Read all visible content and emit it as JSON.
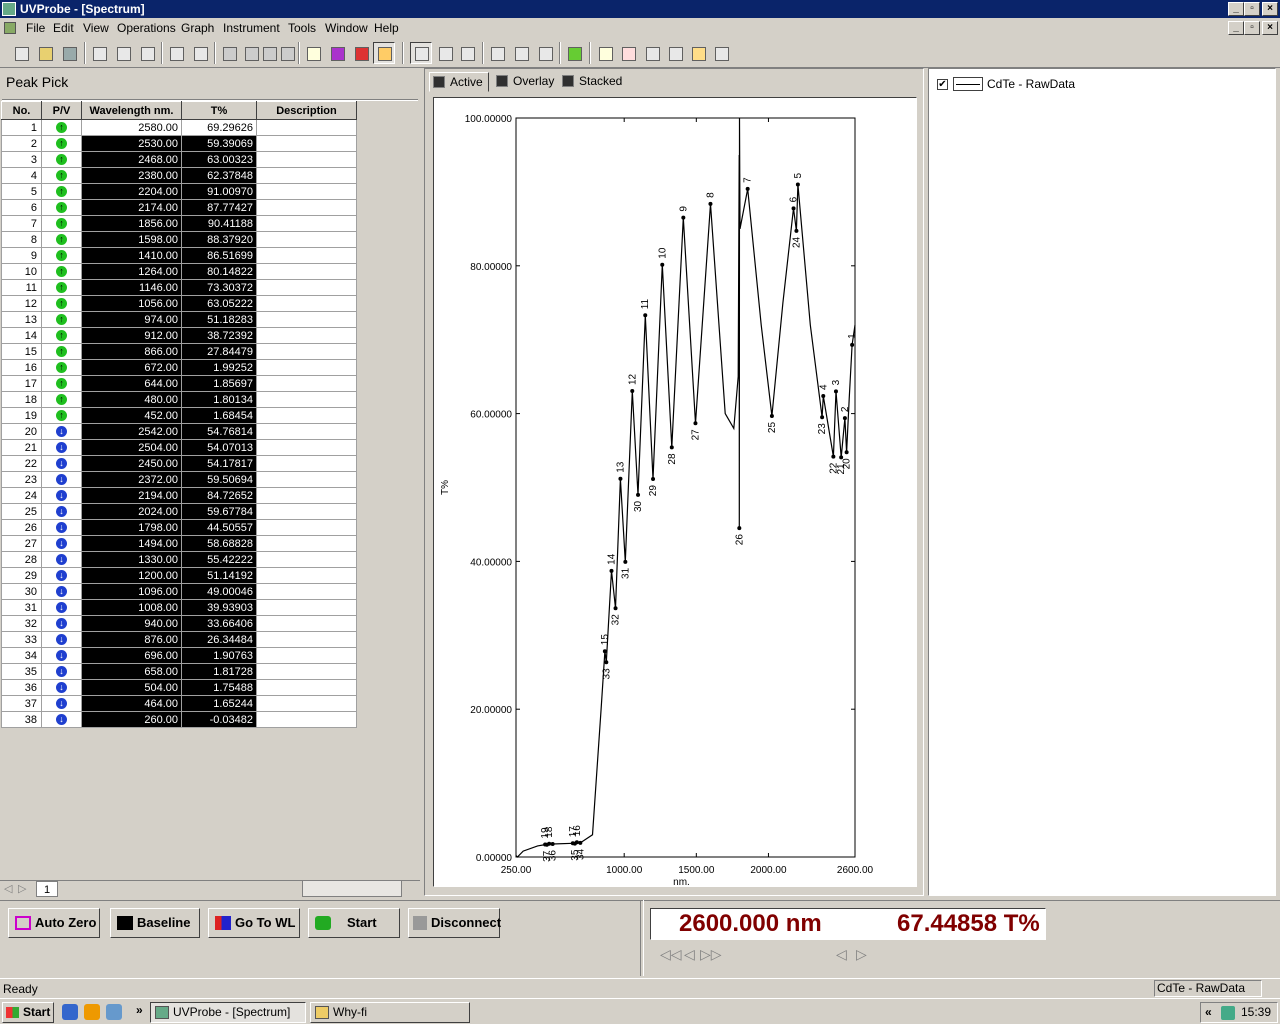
{
  "window": {
    "title": "UVProbe - [Spectrum]"
  },
  "menu": [
    "File",
    "Edit",
    "View",
    "Operations",
    "Graph",
    "Instrument",
    "Tools",
    "Window",
    "Help"
  ],
  "peak_pick": {
    "title": "Peak Pick",
    "columns": [
      "No.",
      "P/V",
      "Wavelength nm.",
      "T%",
      "Description"
    ],
    "rows": [
      [
        "1",
        "P",
        "2580.00",
        "69.29626"
      ],
      [
        "2",
        "P",
        "2530.00",
        "59.39069"
      ],
      [
        "3",
        "P",
        "2468.00",
        "63.00323"
      ],
      [
        "4",
        "P",
        "2380.00",
        "62.37848"
      ],
      [
        "5",
        "P",
        "2204.00",
        "91.00970"
      ],
      [
        "6",
        "P",
        "2174.00",
        "87.77427"
      ],
      [
        "7",
        "P",
        "1856.00",
        "90.41188"
      ],
      [
        "8",
        "P",
        "1598.00",
        "88.37920"
      ],
      [
        "9",
        "P",
        "1410.00",
        "86.51699"
      ],
      [
        "10",
        "P",
        "1264.00",
        "80.14822"
      ],
      [
        "11",
        "P",
        "1146.00",
        "73.30372"
      ],
      [
        "12",
        "P",
        "1056.00",
        "63.05222"
      ],
      [
        "13",
        "P",
        "974.00",
        "51.18283"
      ],
      [
        "14",
        "P",
        "912.00",
        "38.72392"
      ],
      [
        "15",
        "P",
        "866.00",
        "27.84479"
      ],
      [
        "16",
        "P",
        "672.00",
        "1.99252"
      ],
      [
        "17",
        "P",
        "644.00",
        "1.85697"
      ],
      [
        "18",
        "P",
        "480.00",
        "1.80134"
      ],
      [
        "19",
        "P",
        "452.00",
        "1.68454"
      ],
      [
        "20",
        "V",
        "2542.00",
        "54.76814"
      ],
      [
        "21",
        "V",
        "2504.00",
        "54.07013"
      ],
      [
        "22",
        "V",
        "2450.00",
        "54.17817"
      ],
      [
        "23",
        "V",
        "2372.00",
        "59.50694"
      ],
      [
        "24",
        "V",
        "2194.00",
        "84.72652"
      ],
      [
        "25",
        "V",
        "2024.00",
        "59.67784"
      ],
      [
        "26",
        "V",
        "1798.00",
        "44.50557"
      ],
      [
        "27",
        "V",
        "1494.00",
        "58.68828"
      ],
      [
        "28",
        "V",
        "1330.00",
        "55.42222"
      ],
      [
        "29",
        "V",
        "1200.00",
        "51.14192"
      ],
      [
        "30",
        "V",
        "1096.00",
        "49.00046"
      ],
      [
        "31",
        "V",
        "1008.00",
        "39.93903"
      ],
      [
        "32",
        "V",
        "940.00",
        "33.66406"
      ],
      [
        "33",
        "V",
        "876.00",
        "26.34484"
      ],
      [
        "34",
        "V",
        "696.00",
        "1.90763"
      ],
      [
        "35",
        "V",
        "658.00",
        "1.81728"
      ],
      [
        "36",
        "V",
        "504.00",
        "1.75488"
      ],
      [
        "37",
        "V",
        "464.00",
        "1.65244"
      ],
      [
        "38",
        "V",
        "260.00",
        "-0.03482"
      ]
    ],
    "sheet_tab": "1"
  },
  "chart_tabs": [
    "Active",
    "Overlay",
    "Stacked"
  ],
  "chart_data": {
    "type": "line",
    "xlabel": "nm.",
    "ylabel": "T%",
    "xlim": [
      250,
      2600
    ],
    "ylim": [
      0,
      100
    ],
    "x_ticks": [
      "250.00",
      "1000.00",
      "1500.00",
      "2000.00",
      "2600.00"
    ],
    "x_tick_values": [
      250,
      1000,
      1500,
      2000,
      2600
    ],
    "y_ticks": [
      "0.00000",
      "20.00000",
      "40.00000",
      "60.00000",
      "80.00000",
      "100.00000"
    ],
    "y_tick_values": [
      0,
      20,
      40,
      60,
      80,
      100
    ],
    "series": [
      {
        "name": "CdTe - RawData",
        "x": [
          250,
          260,
          300,
          400,
          452,
          464,
          480,
          504,
          644,
          658,
          672,
          696,
          780,
          840,
          866,
          876,
          912,
          940,
          974,
          1008,
          1056,
          1096,
          1146,
          1200,
          1264,
          1330,
          1410,
          1494,
          1598,
          1700,
          1760,
          1790,
          1797,
          1798,
          1799,
          1803,
          1856,
          1950,
          2024,
          2100,
          2174,
          2194,
          2204,
          2290,
          2372,
          2380,
          2450,
          2468,
          2504,
          2530,
          2542,
          2560,
          2580,
          2600
        ],
        "y": [
          0.2,
          -0.03482,
          0.8,
          1.5,
          1.68454,
          1.65244,
          1.80134,
          1.75488,
          1.85697,
          1.81728,
          1.99252,
          1.90763,
          3,
          20,
          27.84479,
          26.34484,
          38.72392,
          33.66406,
          51.18283,
          39.93903,
          63.05222,
          49.00046,
          73.30372,
          51.14192,
          80.14822,
          55.42222,
          86.51699,
          58.68828,
          88.3792,
          60,
          58,
          65,
          95,
          44.50557,
          100,
          85,
          90.41188,
          72,
          59.67784,
          75,
          87.77427,
          84.72652,
          91.0097,
          72,
          59.50694,
          62.37848,
          54.17817,
          63.00323,
          54.07013,
          59.39069,
          54.76814,
          62,
          69.29626,
          72
        ]
      }
    ],
    "peaks": [
      {
        "label": "1",
        "x": 2580,
        "y": 69.29626
      },
      {
        "label": "2",
        "x": 2530,
        "y": 59.39069
      },
      {
        "label": "3",
        "x": 2468,
        "y": 63.00323
      },
      {
        "label": "4",
        "x": 2380,
        "y": 62.37848
      },
      {
        "label": "5",
        "x": 2204,
        "y": 91.0097
      },
      {
        "label": "6",
        "x": 2174,
        "y": 87.77427
      },
      {
        "label": "7",
        "x": 1856,
        "y": 90.41188
      },
      {
        "label": "8",
        "x": 1598,
        "y": 88.3792
      },
      {
        "label": "9",
        "x": 1410,
        "y": 86.51699
      },
      {
        "label": "10",
        "x": 1264,
        "y": 80.14822
      },
      {
        "label": "11",
        "x": 1146,
        "y": 73.30372
      },
      {
        "label": "12",
        "x": 1056,
        "y": 63.05222
      },
      {
        "label": "13",
        "x": 974,
        "y": 51.18283
      },
      {
        "label": "14",
        "x": 912,
        "y": 38.72392
      },
      {
        "label": "15",
        "x": 866,
        "y": 27.84479
      },
      {
        "label": "16",
        "x": 672,
        "y": 1.99252
      },
      {
        "label": "17",
        "x": 644,
        "y": 1.85697
      },
      {
        "label": "18",
        "x": 480,
        "y": 1.80134
      },
      {
        "label": "19",
        "x": 452,
        "y": 1.68454
      }
    ],
    "valleys": [
      {
        "label": "20",
        "x": 2542,
        "y": 54.76814
      },
      {
        "label": "21",
        "x": 2504,
        "y": 54.07013
      },
      {
        "label": "22",
        "x": 2450,
        "y": 54.17817
      },
      {
        "label": "23",
        "x": 2372,
        "y": 59.50694
      },
      {
        "label": "24",
        "x": 2194,
        "y": 84.72652
      },
      {
        "label": "25",
        "x": 2024,
        "y": 59.67784
      },
      {
        "label": "26",
        "x": 1798,
        "y": 44.50557
      },
      {
        "label": "27",
        "x": 1494,
        "y": 58.68828
      },
      {
        "label": "28",
        "x": 1330,
        "y": 55.42222
      },
      {
        "label": "29",
        "x": 1200,
        "y": 51.14192
      },
      {
        "label": "30",
        "x": 1096,
        "y": 49.00046
      },
      {
        "label": "31",
        "x": 1008,
        "y": 39.93903
      },
      {
        "label": "32",
        "x": 940,
        "y": 33.66406
      },
      {
        "label": "33",
        "x": 876,
        "y": 26.34484
      },
      {
        "label": "34",
        "x": 696,
        "y": 1.90763
      },
      {
        "label": "35",
        "x": 658,
        "y": 1.81728
      },
      {
        "label": "36",
        "x": 504,
        "y": 1.75488
      },
      {
        "label": "37",
        "x": 464,
        "y": 1.65244
      }
    ]
  },
  "legend": {
    "checked": "✔",
    "label": "CdTe - RawData"
  },
  "buttons": {
    "auto_zero": "Auto Zero",
    "baseline": "Baseline",
    "goto_wl": "Go To WL",
    "start": "Start",
    "disconnect": "Disconnect"
  },
  "readout": {
    "wavelength": "2600.000 nm",
    "value": "67.44858 T%"
  },
  "status": {
    "left": "Ready",
    "right": "CdTe - RawData"
  },
  "taskbar": {
    "start": "Start",
    "tasks": [
      "UVProbe - [Spectrum]",
      "Why-fi"
    ],
    "clock": "15:39"
  }
}
